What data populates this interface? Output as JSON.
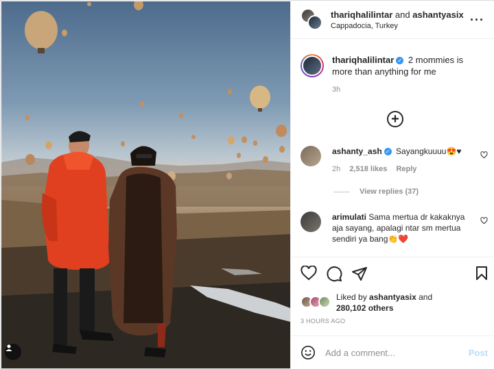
{
  "header": {
    "user1": "thariqhalilintar",
    "joiner": "and",
    "user2": "ashantyasix",
    "location": "Cappadocia, Turkey",
    "more_icon": "ellipsis-icon"
  },
  "caption": {
    "username": "thariqhalilintar",
    "text": "2 mommies is more than anything for me",
    "time": "3h"
  },
  "load_more_icon": "plus-circle-icon",
  "comments": [
    {
      "username": "ashanty_ash",
      "verified": true,
      "text": "Sayangkuuuu😍♥",
      "time": "2h",
      "likes": "2,518 likes",
      "reply": "Reply",
      "view_replies": "View replies (37)"
    },
    {
      "username": "arimulati",
      "verified": false,
      "text": "Sama mertua dr kakaknya aja sayang, apalagi ntar sm mertua sendiri ya bang👏❤️"
    }
  ],
  "actions": {
    "like_icon": "heart-icon",
    "comment_icon": "comment-icon",
    "share_icon": "paper-plane-icon",
    "save_icon": "bookmark-icon"
  },
  "liked_by": {
    "prefix": "Liked by",
    "user": "ashantyasix",
    "and": "and",
    "others": "280,102 others"
  },
  "timeago": "3 HOURS AGO",
  "add_comment": {
    "placeholder": "Add a comment...",
    "post_label": "Post",
    "emoji_icon": "smiley-icon"
  },
  "colors": {
    "verified": "#3897f0",
    "post_disabled": "#b2dffc",
    "muted_text": "#8e8e8e"
  }
}
